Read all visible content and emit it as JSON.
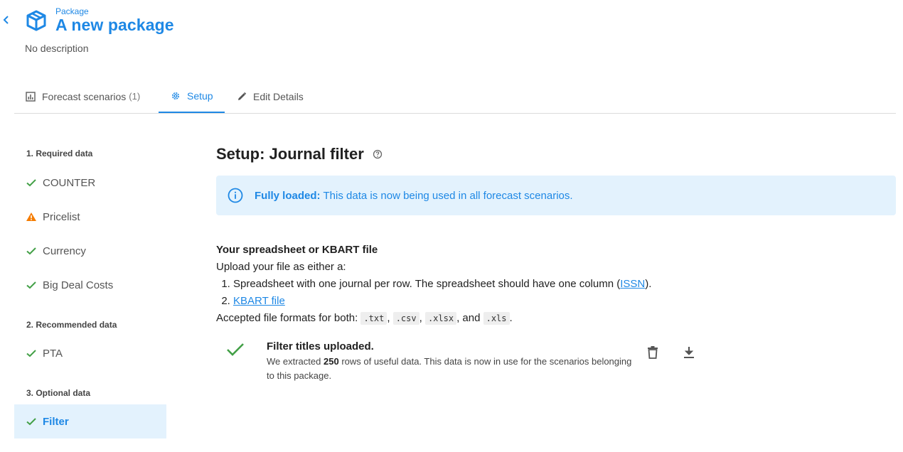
{
  "header": {
    "kicker": "Package",
    "title": "A new package",
    "description": "No description"
  },
  "tabs": [
    {
      "label": "Forecast scenarios",
      "count": "(1)",
      "icon": "bar-chart-icon"
    },
    {
      "label": "Setup",
      "icon": "gear-icon"
    },
    {
      "label": "Edit Details",
      "icon": "pencil-icon"
    }
  ],
  "sidebar": {
    "sections": [
      {
        "heading": "1. Required data",
        "items": [
          {
            "label": "COUNTER",
            "status": "check"
          },
          {
            "label": "Pricelist",
            "status": "warning"
          },
          {
            "label": "Currency",
            "status": "check"
          },
          {
            "label": "Big Deal Costs",
            "status": "check"
          }
        ]
      },
      {
        "heading": "2. Recommended data",
        "items": [
          {
            "label": "PTA",
            "status": "check"
          }
        ]
      },
      {
        "heading": "3. Optional data",
        "items": [
          {
            "label": "Filter",
            "status": "check",
            "active": true
          }
        ]
      }
    ]
  },
  "main": {
    "title": "Setup: Journal filter",
    "alert": {
      "strong": "Fully loaded:",
      "text": "This data is now being used in all forecast scenarios."
    },
    "upload": {
      "heading": "Your spreadsheet or KBART file",
      "intro": "Upload your file as either a:",
      "item1_text": "Spreadsheet with one journal per row. The spreadsheet should have one column (",
      "item1_link": "ISSN",
      "item1_end": ").",
      "item2_link": "KBART file",
      "formats_prefix": "Accepted file formats for both:",
      "formats": [
        ".txt",
        ".csv",
        ".xlsx",
        ".xls"
      ],
      "and_word": "and"
    },
    "uploaded": {
      "title": "Filter titles uploaded.",
      "desc_prefix": "We extracted",
      "rows": "250",
      "desc_suffix": "rows of useful data. This data is now in use for the scenarios belonging to this package."
    }
  },
  "colors": {
    "accent": "#1e88e5",
    "success": "#43a047",
    "warning": "#f57c00",
    "alert_bg": "#e3f2fd"
  }
}
